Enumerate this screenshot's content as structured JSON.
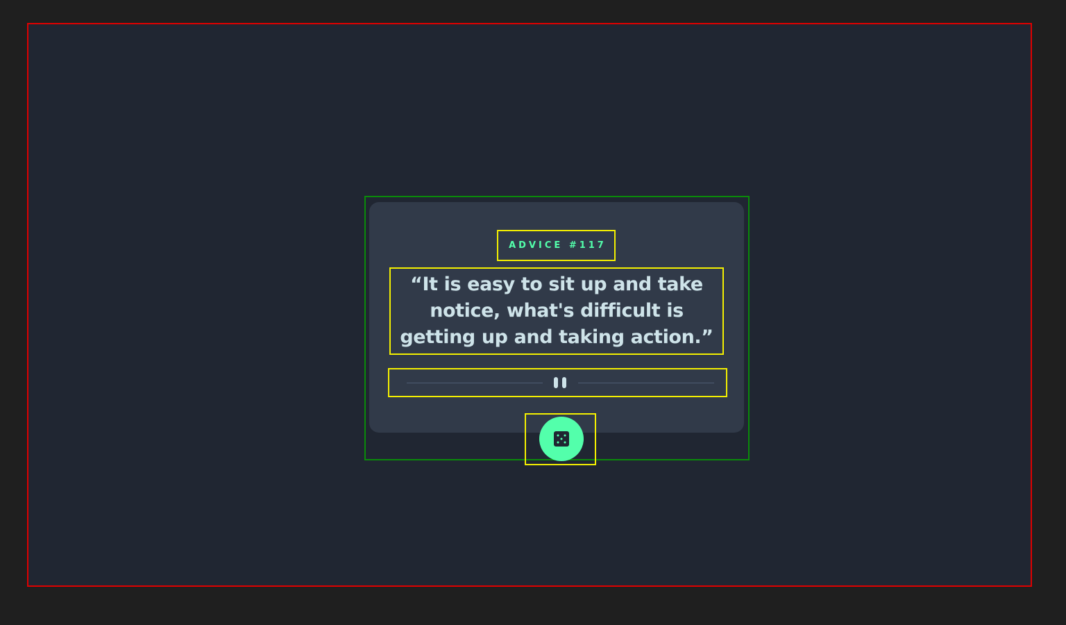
{
  "app": {
    "background_color": "#202632",
    "card_color": "#313a49",
    "accent_color": "#53ffab",
    "text_color": "#cee3e9"
  },
  "advice": {
    "id_label": "ADVICE #117",
    "quote": "“It is easy to sit up and take notice, what's difficult is getting up and taking action.”"
  },
  "divider": {
    "icon": "pause-icon"
  },
  "dice_button": {
    "icon": "dice-icon"
  }
}
